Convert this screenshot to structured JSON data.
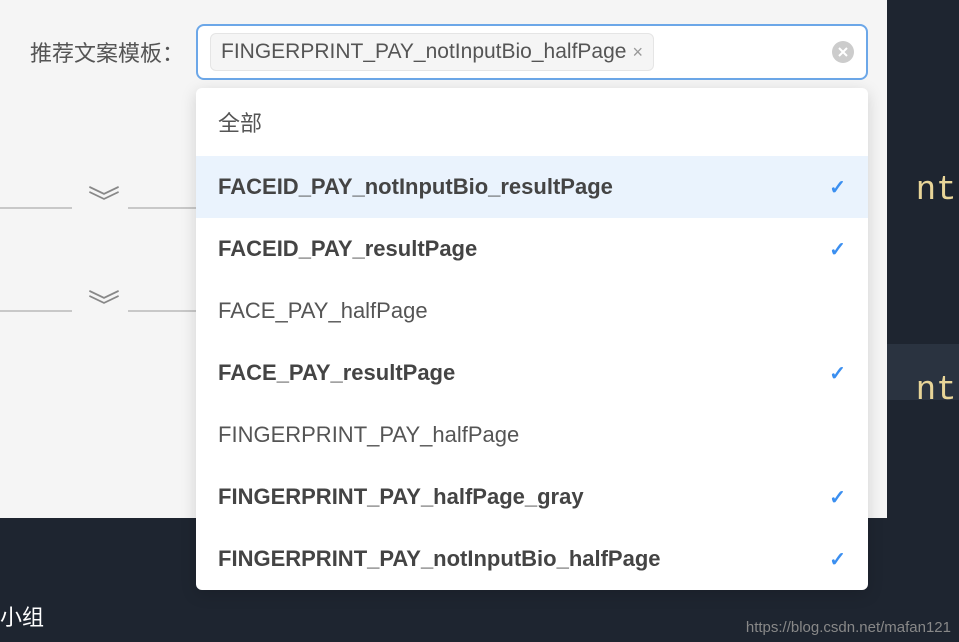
{
  "label": "推荐文案模板：",
  "selectedTag": "FINGERPRINT_PAY_notInputBio_halfPage",
  "dropdownHeader": "全部",
  "options": [
    {
      "label": "FACEID_PAY_notInputBio_resultPage",
      "selected": true,
      "highlighted": true
    },
    {
      "label": "FACEID_PAY_resultPage",
      "selected": true,
      "highlighted": false
    },
    {
      "label": "FACE_PAY_halfPage",
      "selected": false,
      "highlighted": false
    },
    {
      "label": "FACE_PAY_resultPage",
      "selected": true,
      "highlighted": false
    },
    {
      "label": "FINGERPRINT_PAY_halfPage",
      "selected": false,
      "highlighted": false
    },
    {
      "label": "FINGERPRINT_PAY_halfPage_gray",
      "selected": true,
      "highlighted": false
    },
    {
      "label": "FINGERPRINT_PAY_notInputBio_halfPage",
      "selected": true,
      "highlighted": false
    }
  ],
  "sideText1": "nt-",
  "sideText2": "nt-",
  "footerText": "小组",
  "watermark": "https://blog.csdn.net/mafan121"
}
